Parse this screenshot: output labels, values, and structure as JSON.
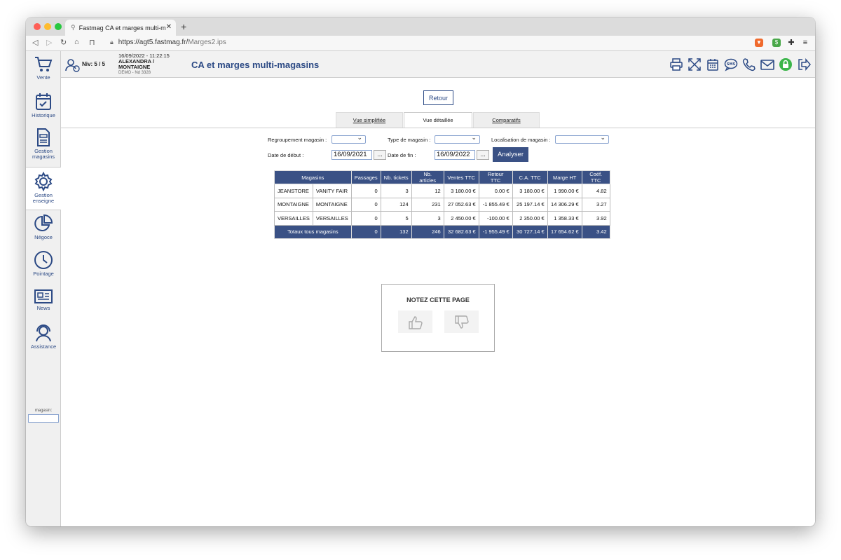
{
  "browser": {
    "tab_title": "Fastmag CA et marges multi-m",
    "url_host": "https://agt5.fastmag.fr/",
    "url_path": "Marges2.ips"
  },
  "sidebar": {
    "items": [
      {
        "label": "Vente",
        "icon": "cart-icon"
      },
      {
        "label": "Historique",
        "icon": "calendar-check-icon"
      },
      {
        "label": "Gestion magasins",
        "icon": "document-icon"
      },
      {
        "label": "Gestion enseigne",
        "icon": "gear-icon"
      },
      {
        "label": "Négoce",
        "icon": "pie-chart-icon"
      },
      {
        "label": "Pointage",
        "icon": "clock-icon"
      },
      {
        "label": "News",
        "icon": "newspaper-icon"
      },
      {
        "label": "Assistance",
        "icon": "headset-icon"
      }
    ],
    "magasin_label": "magasin:"
  },
  "header": {
    "niveau": "Niv: 5 / 5",
    "datetime": "16/09/2022 - 11:22:15",
    "user": "ALEXANDRA /",
    "store": "MONTAIGNE",
    "demo": "DEMO - Nd 3328",
    "title": "CA et marges multi-magasins"
  },
  "page": {
    "retour_label": "Retour",
    "tabs": [
      {
        "label": "Vue simplifiée"
      },
      {
        "label": "Vue détaillée"
      },
      {
        "label": "Comparatifs"
      }
    ],
    "filters": {
      "regroupement_label": "Regroupement magasin :",
      "type_label": "Type de magasin :",
      "localisation_label": "Localisation de magasin :",
      "date_debut_label": "Date de début :",
      "date_debut_value": "16/09/2021",
      "date_fin_label": "Date de fin :",
      "date_fin_value": "16/09/2022",
      "dots": "...",
      "analyser_label": "Analyser"
    },
    "table": {
      "headers": [
        "Magasins",
        "Passages",
        "Nb. tickets",
        "Nb. articles",
        "Ventes TTC",
        "Retour TTC",
        "C.A. TTC",
        "Marge HT",
        "Coéf. TTC"
      ],
      "rows": [
        [
          "JEANSTORE",
          "VANITY FAIR",
          "0",
          "3",
          "12",
          "3 180.00 €",
          "0.00 €",
          "3 180.00 €",
          "1 990.00 €",
          "4.82"
        ],
        [
          "MONTAIGNE",
          "MONTAIGNE",
          "0",
          "124",
          "231",
          "27 052.63 €",
          "-1 855.49 €",
          "25 197.14 €",
          "14 306.29 €",
          "3.27"
        ],
        [
          "VERSAILLES",
          "VERSAILLES",
          "0",
          "5",
          "3",
          "2 450.00 €",
          "-100.00 €",
          "2 350.00 €",
          "1 358.33 €",
          "3.92"
        ]
      ],
      "total": [
        "Totaux tous magasins",
        "0",
        "132",
        "246",
        "32 682.63 €",
        "-1 955.49 €",
        "30 727.14 €",
        "17 654.62 €",
        "3.42"
      ]
    },
    "rating": {
      "title": "NOTEZ CETTE PAGE"
    }
  }
}
